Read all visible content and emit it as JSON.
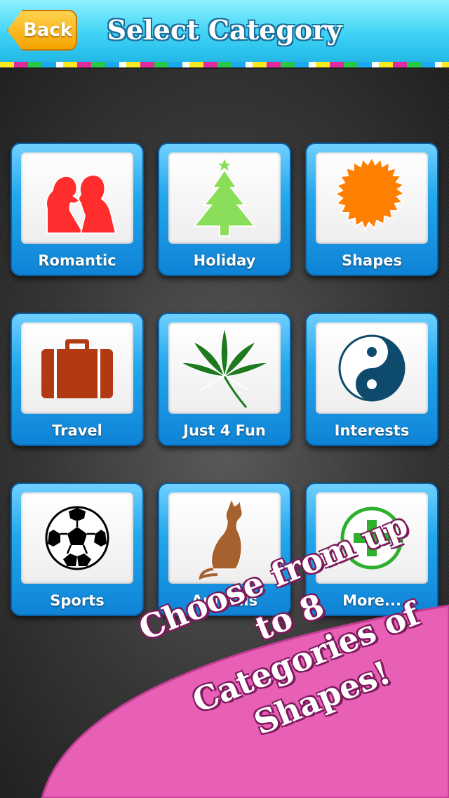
{
  "header": {
    "back_label": "Back",
    "title": "Select Category"
  },
  "categories": [
    {
      "label": "Romantic",
      "icon": "kissing-couple-icon",
      "color": "#ff2d2d"
    },
    {
      "label": "Holiday",
      "icon": "christmas-tree-icon",
      "color": "#8bde5a"
    },
    {
      "label": "Shapes",
      "icon": "starburst-icon",
      "color": "#ff7f00"
    },
    {
      "label": "Travel",
      "icon": "suitcase-icon",
      "color": "#b23a12"
    },
    {
      "label": "Just 4 Fun",
      "icon": "cannabis-leaf-icon",
      "color": "#1f7a1f"
    },
    {
      "label": "Interests",
      "icon": "yin-yang-icon",
      "color": "#0e4a6b"
    },
    {
      "label": "Sports",
      "icon": "soccer-ball-icon",
      "color": "#000000"
    },
    {
      "label": "Animals",
      "icon": "cat-icon",
      "color": "#a6612e"
    },
    {
      "label": "More...",
      "icon": "plus-circle-icon",
      "color": "#2db02d"
    }
  ],
  "promo": {
    "line1": "Choose from up to 8",
    "line2": "Categories of",
    "line3": "Shapes!",
    "color": "#e85fb6"
  }
}
